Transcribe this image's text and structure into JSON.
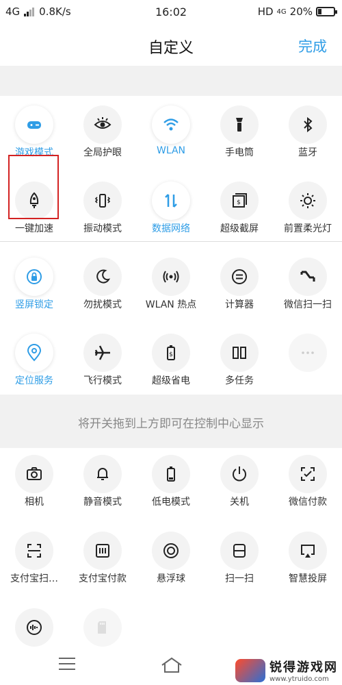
{
  "status_bar": {
    "network": "4G",
    "speed": "0.8K/s",
    "time": "16:02",
    "hd": "HD",
    "network2": "4G",
    "battery": "20%",
    "battery_level": 0.2
  },
  "header": {
    "title": "自定义",
    "done_label": "完成"
  },
  "accent_color": "#2f9de6",
  "active_tiles": [
    {
      "label": "游戏模式",
      "icon": "gamepad-icon",
      "state": "on"
    },
    {
      "label": "全局护眼",
      "icon": "eye-icon",
      "state": "off"
    },
    {
      "label": "WLAN",
      "icon": "wifi-icon",
      "state": "on"
    },
    {
      "label": "手电筒",
      "icon": "flashlight-icon",
      "state": "off"
    },
    {
      "label": "蓝牙",
      "icon": "bluetooth-icon",
      "state": "off"
    },
    {
      "label": "一键加速",
      "icon": "rocket-icon",
      "state": "off"
    },
    {
      "label": "振动模式",
      "icon": "vibrate-icon",
      "state": "off"
    },
    {
      "label": "数据网络",
      "icon": "data-network-icon",
      "state": "on"
    },
    {
      "label": "超级截屏",
      "icon": "screenshot-icon",
      "state": "off"
    },
    {
      "label": "前置柔光灯",
      "icon": "sun-icon",
      "state": "off"
    },
    {
      "label": "竖屏锁定",
      "icon": "rotation-lock-icon",
      "state": "on"
    },
    {
      "label": "勿扰模式",
      "icon": "moon-icon",
      "state": "off"
    },
    {
      "label": "WLAN 热点",
      "icon": "hotspot-icon",
      "state": "off"
    },
    {
      "label": "计算器",
      "icon": "calculator-icon",
      "state": "off"
    },
    {
      "label": "微信扫一扫",
      "icon": "wechat-scan-icon",
      "state": "off"
    },
    {
      "label": "定位服务",
      "icon": "location-icon",
      "state": "on"
    },
    {
      "label": "飞行模式",
      "icon": "airplane-icon",
      "state": "off"
    },
    {
      "label": "超级省电",
      "icon": "battery-saver-icon",
      "state": "off"
    },
    {
      "label": "多任务",
      "icon": "multitask-icon",
      "state": "off"
    },
    {
      "label": "",
      "icon": "more-icon",
      "state": "disabled"
    }
  ],
  "hint": "将开关拖到上方即可在控制中心显示",
  "available_tiles": [
    {
      "label": "相机",
      "icon": "camera-icon"
    },
    {
      "label": "静音模式",
      "icon": "bell-icon"
    },
    {
      "label": "低电模式",
      "icon": "low-battery-icon"
    },
    {
      "label": "关机",
      "icon": "power-icon"
    },
    {
      "label": "微信付款",
      "icon": "wechat-pay-icon"
    },
    {
      "label": "支付宝扫…",
      "icon": "alipay-scan-icon"
    },
    {
      "label": "支付宝付款",
      "icon": "alipay-pay-icon"
    },
    {
      "label": "悬浮球",
      "icon": "float-ball-icon"
    },
    {
      "label": "扫一扫",
      "icon": "scan-icon"
    },
    {
      "label": "智慧投屏",
      "icon": "cast-icon"
    },
    {
      "label": "",
      "icon": "voice-icon"
    },
    {
      "label": "",
      "icon": "sd-card-icon"
    }
  ],
  "watermark": {
    "name": "锐得游戏网",
    "url": "www.ytruido.com"
  }
}
